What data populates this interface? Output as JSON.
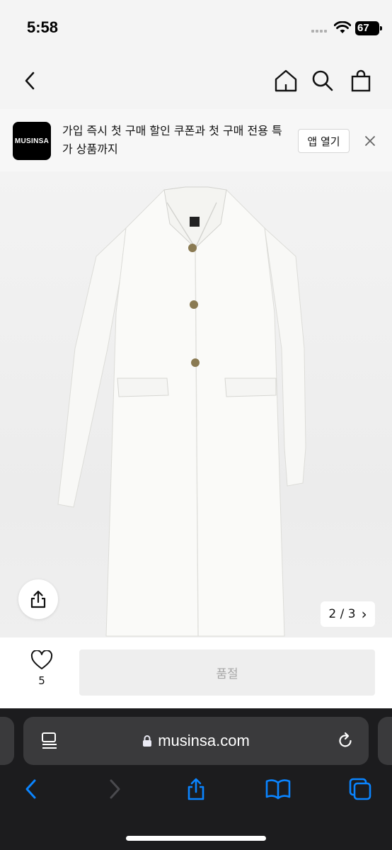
{
  "status_bar": {
    "time": "5:58",
    "battery": "67"
  },
  "banner": {
    "logo_text": "MUSINSA",
    "message": "가입 즉시 첫 구매 할인 쿠폰과 첫 구매 전용 특가 상품까지",
    "open_app_label": "앱 열기"
  },
  "gallery": {
    "page_indicator": "2 / 3",
    "next_glyph": "›"
  },
  "product": {
    "like_count": "5",
    "buy_button_label": "품절"
  },
  "browser": {
    "url": "musinsa.com"
  },
  "colors": {
    "safari_accent": "#0a84ff",
    "soldout_bg": "#eeeeee"
  },
  "icons": [
    "back-icon",
    "home-icon",
    "search-icon",
    "bag-icon",
    "close-icon",
    "share-icon",
    "heart-icon",
    "reader-icon",
    "lock-icon",
    "reload-icon",
    "forward-icon",
    "bookmarks-icon",
    "tabs-icon"
  ]
}
